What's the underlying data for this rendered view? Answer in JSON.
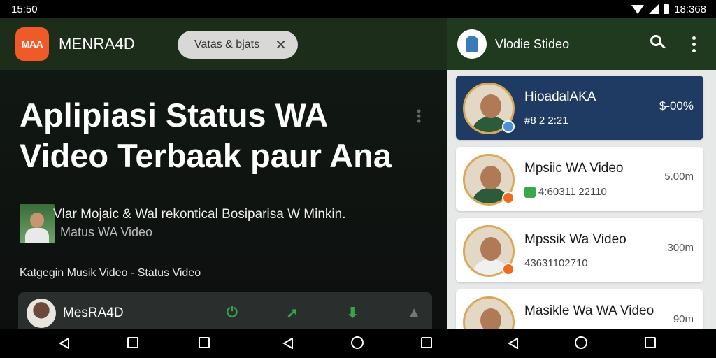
{
  "status_bar": {
    "time": "15:50",
    "battery_text": "18:368"
  },
  "left": {
    "app": {
      "logo_text": "MAA",
      "name": "MENRA4D"
    },
    "chip": {
      "label": "Vatas & bjats",
      "close": "✕"
    },
    "headline": [
      "Aplipiasi Status WA",
      "Video Terbaak paur Ana"
    ],
    "sub_line1": "Vlar Mojaic & Wal rekontical Bosiparisa W  Minkin.",
    "sub_line2": "Matus WA Video",
    "category": "Katgegin Musik Video - Status Video",
    "player": {
      "name": "MesRA4D"
    }
  },
  "right": {
    "title": "Vlodie Stideo",
    "items": [
      {
        "title": "HioadalAKA",
        "meta": "#8 2 2:21",
        "size": "$-00%",
        "selected": true
      },
      {
        "title": "Mpsiic WA Video",
        "meta": "4:60311 22110",
        "size": "5.00m",
        "selected": false
      },
      {
        "title": "Mpssik Wa Video",
        "meta": "43631102710",
        "size": "300m",
        "selected": false
      },
      {
        "title": "Masikle Wa WA Video",
        "meta": "",
        "size": "90m",
        "selected": false
      }
    ]
  },
  "icons": {
    "wifi": "wifi-icon",
    "signal": "signal-icon",
    "battery": "battery-icon",
    "search": "search-icon",
    "more": "more-vert-icon",
    "back": "back-icon",
    "home": "home-icon",
    "recents": "recents-icon"
  }
}
